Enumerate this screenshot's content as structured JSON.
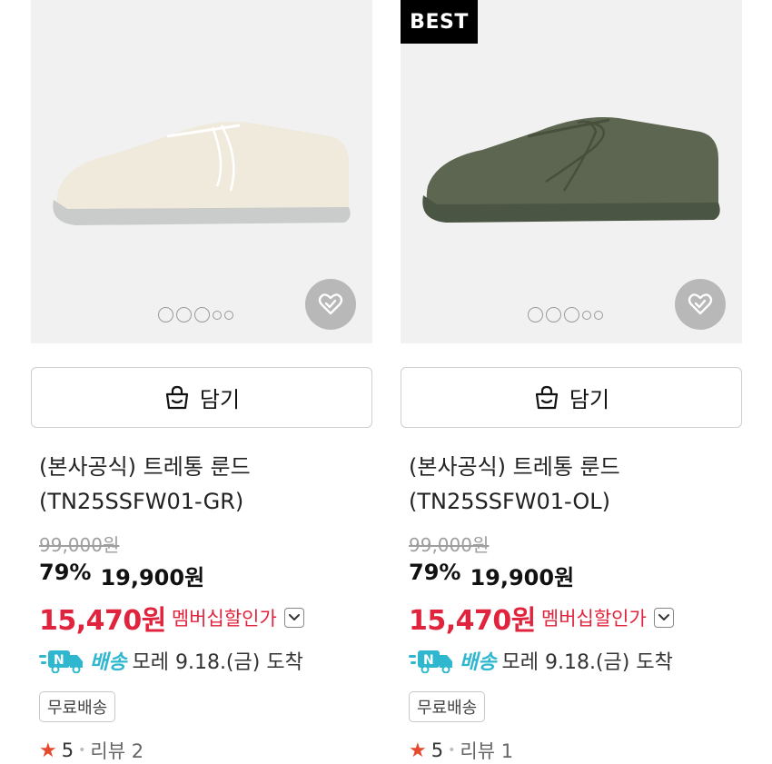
{
  "products": [
    {
      "badge": "",
      "cart_label": "담기",
      "title_line1": "(본사공식) 트레통 룬드",
      "title_line2": "(TN25SSFW01-GR)",
      "original_price": "99,000원",
      "discount_rate": "79%",
      "sale_price": "19,900원",
      "member_price": "15,470원",
      "member_label": "멤버십할인가",
      "shipping_label": "배송",
      "shipping_text": "모레 9.18.(금) 도착",
      "free_shipping": "무료배송",
      "rating": "5",
      "review_text": "리뷰 2",
      "shoe_color": "#efeadb",
      "sole_color": "#c9cccb"
    },
    {
      "badge": "BEST",
      "cart_label": "담기",
      "title_line1": "(본사공식) 트레통 룬드",
      "title_line2": "(TN25SSFW01-OL)",
      "original_price": "99,000원",
      "discount_rate": "79%",
      "sale_price": "19,900원",
      "member_price": "15,470원",
      "member_label": "멤버십할인가",
      "shipping_label": "배송",
      "shipping_text": "모레 9.18.(금) 도착",
      "free_shipping": "무료배송",
      "rating": "5",
      "review_text": "리뷰 1",
      "shoe_color": "#5d6650",
      "sole_color": "#4a5643"
    }
  ],
  "colors": {
    "accent_red": "#e0243d",
    "shipping_cyan": "#2fb7cf",
    "star": "#e64a2e"
  },
  "icons": {
    "cart": "shopping-bag-icon",
    "wish": "heart-check-icon",
    "shipping": "delivery-truck-icon",
    "star": "star-icon",
    "chevron": "chevron-down-icon"
  }
}
